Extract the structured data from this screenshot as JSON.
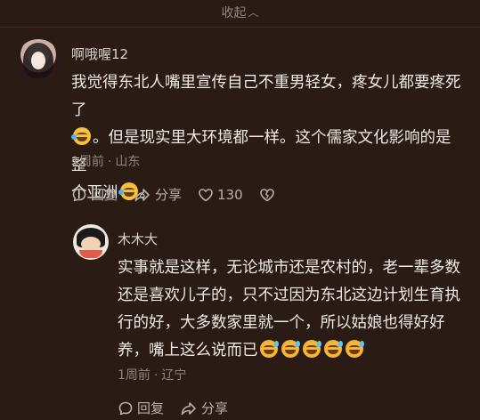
{
  "collapse": {
    "label": "收起",
    "icon": "chevron-up-icon"
  },
  "comment": {
    "username": "啊哦喔12",
    "text_line1": "我觉得东北人嘴里宣传自己不重男轻女，疼女儿都要疼死了",
    "text_line2_after_emoji": "。但是现实里大环境都一样。这个儒家文化影响的是整",
    "text_line3": "个亚洲",
    "text_line3_end": "。",
    "time": "1周前",
    "location": "山东",
    "reply_label": "回复",
    "share_label": "分享",
    "like_count": "130",
    "icons": [
      "comment-icon",
      "share-icon",
      "heart-icon",
      "broken-heart-icon",
      "laughing-tears-emoji"
    ]
  },
  "reply": {
    "username": "木木大",
    "text_line1": "实事就是这样，无论城市还是农村的，老一辈多数",
    "text_line2": "还是喜欢儿子的，只不过因为东北这边计划生育执",
    "text_line3": "行的好，大多数家里就一个，所以姑娘也得好好",
    "text_line4": "养，嘴上这么说而已",
    "time": "1周前",
    "location": "辽宁",
    "reply_label": "回复",
    "share_label": "分享",
    "icons": [
      "comment-icon",
      "share-icon",
      "sweating-smile-emoji"
    ]
  },
  "colors": {
    "background": "#2a1c15",
    "text": "#efe9e5",
    "muted": "#8f857e"
  }
}
